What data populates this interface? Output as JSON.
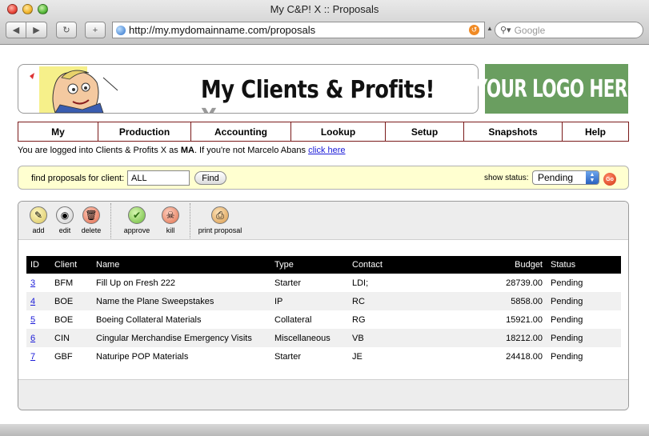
{
  "browser": {
    "window_title": "My C&P! X :: Proposals",
    "url": "http://my.mydomainname.com/proposals",
    "search_placeholder": "Google"
  },
  "banner": {
    "title_main": "My Clients & Profits!",
    "title_suffix": "X",
    "logo_text": "YOUR LOGO HERE"
  },
  "menu": [
    {
      "label": "My"
    },
    {
      "label": "Production"
    },
    {
      "label": "Accounting"
    },
    {
      "label": "Lookup"
    },
    {
      "label": "Setup"
    },
    {
      "label": "Snapshots"
    },
    {
      "label": "Help"
    }
  ],
  "login": {
    "prefix": "You are logged into Clients & Profits X as ",
    "user": "MA",
    "middle": ". If you're not Marcelo Abans ",
    "link": "click here"
  },
  "find": {
    "label": "find proposals for client:",
    "value": "ALL",
    "button": "Find",
    "status_label": "show status:",
    "status_value": "Pending",
    "go_label": "Go"
  },
  "toolbar": {
    "add": "add",
    "edit": "edit",
    "delete": "delete",
    "approve": "approve",
    "kill": "kill",
    "print": "print proposal"
  },
  "table": {
    "headers": {
      "id": "ID",
      "client": "Client",
      "name": "Name",
      "type": "Type",
      "contact": "Contact",
      "budget": "Budget",
      "status": "Status"
    },
    "rows": [
      {
        "id": "3",
        "client": "BFM",
        "name": "Fill Up on Fresh 222",
        "type": "Starter",
        "contact": "LDI;",
        "budget": "28739.00",
        "status": "Pending"
      },
      {
        "id": "4",
        "client": "BOE",
        "name": "Name the Plane Sweepstakes",
        "type": "IP",
        "contact": "RC",
        "budget": "5858.00",
        "status": "Pending"
      },
      {
        "id": "5",
        "client": "BOE",
        "name": "Boeing Collateral Materials",
        "type": "Collateral",
        "contact": "RG",
        "budget": "15921.00",
        "status": "Pending"
      },
      {
        "id": "6",
        "client": "CIN",
        "name": "Cingular Merchandise Emergency Visits",
        "type": "Miscellaneous",
        "contact": "VB",
        "budget": "18212.00",
        "status": "Pending"
      },
      {
        "id": "7",
        "client": "GBF",
        "name": "Naturipe POP Materials",
        "type": "Starter",
        "contact": "JE",
        "budget": "24418.00",
        "status": "Pending"
      }
    ]
  }
}
